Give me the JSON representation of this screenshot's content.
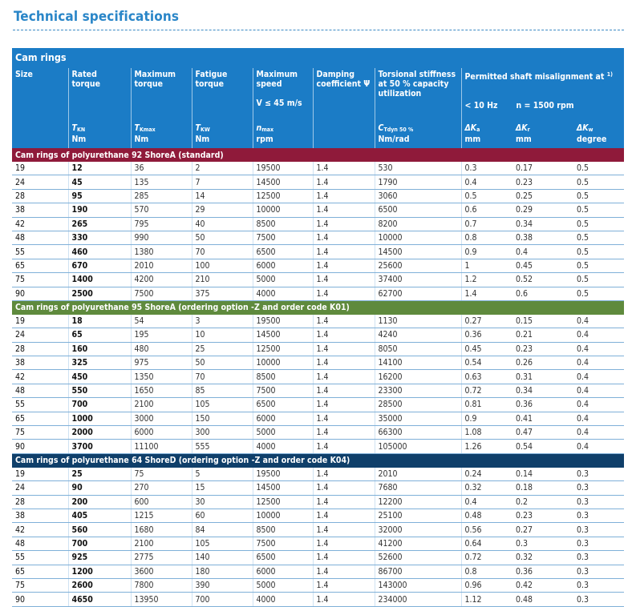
{
  "page": {
    "title": "Technical specifications"
  },
  "header": {
    "section_title": "Cam rings",
    "columns": [
      {
        "name": "Size",
        "cond": "",
        "sym": "",
        "sub": "",
        "unit": ""
      },
      {
        "name": "Rated torque",
        "cond": "",
        "sym": "T",
        "sub": "KN",
        "unit": "Nm"
      },
      {
        "name": "Maximum torque",
        "cond": "",
        "sym": "T",
        "sub": "Kmax",
        "unit": "Nm"
      },
      {
        "name": "Fatigue torque",
        "cond": "",
        "sym": "T",
        "sub": "KW",
        "unit": "Nm"
      },
      {
        "name": "Maximum speed",
        "cond": "V ≤ 45 m/s",
        "sym": "n",
        "sub": "max",
        "unit": "rpm"
      },
      {
        "name": "Damping coefficient Ψ",
        "cond": "",
        "sym": "",
        "sub": "",
        "unit": ""
      },
      {
        "name": "Torsional stiffness at 50 % capacity utilization",
        "cond": "",
        "sym": "C",
        "sub": "Tdyn 50 %",
        "unit": "Nm/rad"
      },
      {
        "name": "",
        "cond": "< 10 Hz",
        "sym": "ΔK",
        "sub": "a",
        "unit": "mm"
      },
      {
        "name": "",
        "cond": "n = 1500 rpm",
        "sym": "ΔK",
        "sub": "r",
        "unit": "mm"
      },
      {
        "name": "",
        "cond": "",
        "sym": "ΔK",
        "sub": "w",
        "unit": "degree"
      }
    ],
    "misalignment_title": "Permitted shaft misalignment at",
    "misalignment_footnote": "1)"
  },
  "groups": [
    {
      "title": "Cam rings of polyurethane 92 ShoreA (standard)",
      "rows": [
        [
          "19",
          "12",
          "36",
          "2",
          "19500",
          "1.4",
          "530",
          "0.3",
          "0.17",
          "0.5"
        ],
        [
          "24",
          "45",
          "135",
          "7",
          "14500",
          "1.4",
          "1790",
          "0.4",
          "0.23",
          "0.5"
        ],
        [
          "28",
          "95",
          "285",
          "14",
          "12500",
          "1.4",
          "3060",
          "0.5",
          "0.25",
          "0.5"
        ],
        [
          "38",
          "190",
          "570",
          "29",
          "10000",
          "1.4",
          "6500",
          "0.6",
          "0.29",
          "0.5"
        ],
        [
          "42",
          "265",
          "795",
          "40",
          "8500",
          "1.4",
          "8200",
          "0.7",
          "0.34",
          "0.5"
        ],
        [
          "48",
          "330",
          "990",
          "50",
          "7500",
          "1.4",
          "10000",
          "0.8",
          "0.38",
          "0.5"
        ],
        [
          "55",
          "460",
          "1380",
          "70",
          "6500",
          "1.4",
          "14500",
          "0.9",
          "0.4",
          "0.5"
        ],
        [
          "65",
          "670",
          "2010",
          "100",
          "6000",
          "1.4",
          "25600",
          "1",
          "0.45",
          "0.5"
        ],
        [
          "75",
          "1400",
          "4200",
          "210",
          "5000",
          "1.4",
          "37400",
          "1.2",
          "0.52",
          "0.5"
        ],
        [
          "90",
          "2500",
          "7500",
          "375",
          "4000",
          "1.4",
          "62700",
          "1.4",
          "0.6",
          "0.5"
        ]
      ]
    },
    {
      "title": "Cam rings of polyurethane 95 ShoreA (ordering option -Z and order code K01)",
      "rows": [
        [
          "19",
          "18",
          "54",
          "3",
          "19500",
          "1.4",
          "1130",
          "0.27",
          "0.15",
          "0.4"
        ],
        [
          "24",
          "65",
          "195",
          "10",
          "14500",
          "1.4",
          "4240",
          "0.36",
          "0.21",
          "0.4"
        ],
        [
          "28",
          "160",
          "480",
          "25",
          "12500",
          "1.4",
          "8050",
          "0.45",
          "0.23",
          "0.4"
        ],
        [
          "38",
          "325",
          "975",
          "50",
          "10000",
          "1.4",
          "14100",
          "0.54",
          "0.26",
          "0.4"
        ],
        [
          "42",
          "450",
          "1350",
          "70",
          "8500",
          "1.4",
          "16200",
          "0.63",
          "0.31",
          "0.4"
        ],
        [
          "48",
          "550",
          "1650",
          "85",
          "7500",
          "1.4",
          "23300",
          "0.72",
          "0.34",
          "0.4"
        ],
        [
          "55",
          "700",
          "2100",
          "105",
          "6500",
          "1.4",
          "28500",
          "0.81",
          "0.36",
          "0.4"
        ],
        [
          "65",
          "1000",
          "3000",
          "150",
          "6000",
          "1.4",
          "35000",
          "0.9",
          "0.41",
          "0.4"
        ],
        [
          "75",
          "2000",
          "6000",
          "300",
          "5000",
          "1.4",
          "66300",
          "1.08",
          "0.47",
          "0.4"
        ],
        [
          "90",
          "3700",
          "11100",
          "555",
          "4000",
          "1.4",
          "105000",
          "1.26",
          "0.54",
          "0.4"
        ]
      ]
    },
    {
      "title": "Cam rings of polyurethane 64 ShoreD (ordering option -Z and order code K04)",
      "rows": [
        [
          "19",
          "25",
          "75",
          "5",
          "19500",
          "1.4",
          "2010",
          "0.24",
          "0.14",
          "0.3"
        ],
        [
          "24",
          "90",
          "270",
          "15",
          "14500",
          "1.4",
          "7680",
          "0.32",
          "0.18",
          "0.3"
        ],
        [
          "28",
          "200",
          "600",
          "30",
          "12500",
          "1.4",
          "12200",
          "0.4",
          "0.2",
          "0.3"
        ],
        [
          "38",
          "405",
          "1215",
          "60",
          "10000",
          "1.4",
          "25100",
          "0.48",
          "0.23",
          "0.3"
        ],
        [
          "42",
          "560",
          "1680",
          "84",
          "8500",
          "1.4",
          "32000",
          "0.56",
          "0.27",
          "0.3"
        ],
        [
          "48",
          "700",
          "2100",
          "105",
          "7500",
          "1.4",
          "41200",
          "0.64",
          "0.3",
          "0.3"
        ],
        [
          "55",
          "925",
          "2775",
          "140",
          "6500",
          "1.4",
          "52600",
          "0.72",
          "0.32",
          "0.3"
        ],
        [
          "65",
          "1200",
          "3600",
          "180",
          "6000",
          "1.4",
          "86700",
          "0.8",
          "0.36",
          "0.3"
        ],
        [
          "75",
          "2600",
          "7800",
          "390",
          "5000",
          "1.4",
          "143000",
          "0.96",
          "0.42",
          "0.3"
        ],
        [
          "90",
          "4650",
          "13950",
          "700",
          "4000",
          "1.4",
          "234000",
          "1.12",
          "0.48",
          "0.3"
        ]
      ]
    }
  ]
}
